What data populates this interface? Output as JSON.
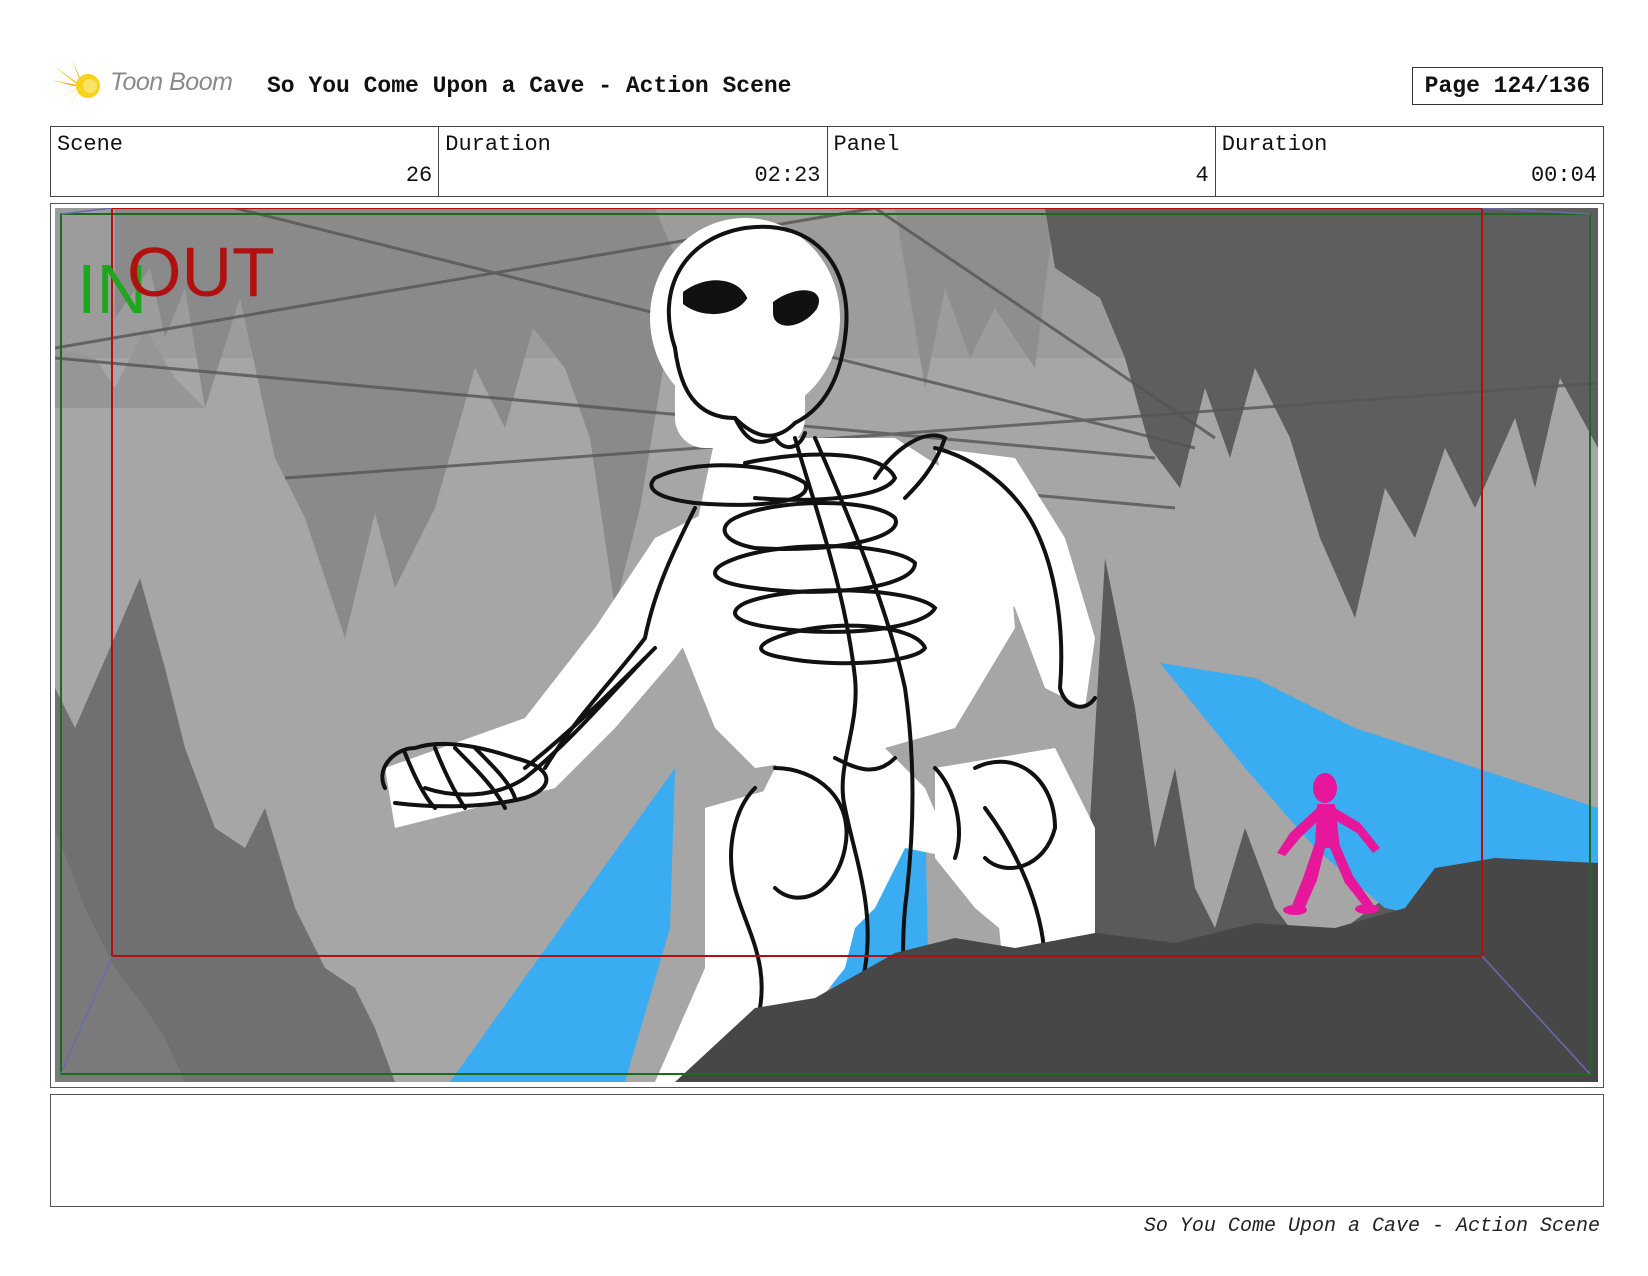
{
  "header": {
    "logo_text": "Toon Boom",
    "title": "So You Come Upon a Cave - Action Scene",
    "page_label": "Page 124/136"
  },
  "info": {
    "scene_label": "Scene",
    "scene_value": "26",
    "scene_duration_label": "Duration",
    "scene_duration_value": "02:23",
    "panel_label": "Panel",
    "panel_value": "4",
    "panel_duration_label": "Duration",
    "panel_duration_value": "00:04"
  },
  "panel": {
    "in_marker": "IN",
    "out_marker": "OUT",
    "in_color": "#1fa51f",
    "out_color": "#b01010"
  },
  "caption": {
    "text": ""
  },
  "footer": {
    "text": "So You Come Upon a Cave - Action Scene"
  }
}
